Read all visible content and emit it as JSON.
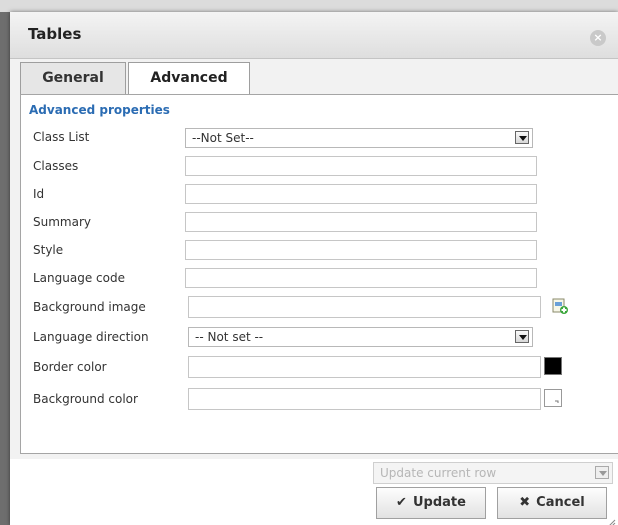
{
  "dialog": {
    "title": "Tables",
    "tabs": [
      {
        "label": "General",
        "active": false
      },
      {
        "label": "Advanced",
        "active": true
      }
    ],
    "section_legend": "Advanced properties",
    "fields": {
      "class_list": {
        "label": "Class List",
        "value": "--Not Set--"
      },
      "classes": {
        "label": "Classes",
        "value": ""
      },
      "id": {
        "label": "Id",
        "value": ""
      },
      "summary": {
        "label": "Summary",
        "value": ""
      },
      "style": {
        "label": "Style",
        "value": ""
      },
      "language_code": {
        "label": "Language code",
        "value": ""
      },
      "background_image": {
        "label": "Background image",
        "value": ""
      },
      "language_direction": {
        "label": "Language direction",
        "value": "-- Not set --"
      },
      "border_color": {
        "label": "Border color",
        "value": "",
        "swatch": "#000000"
      },
      "background_color": {
        "label": "Background color",
        "value": "",
        "swatch": "#ffffff"
      }
    },
    "footer": {
      "apply_scope": "Update current row",
      "update_label": "Update",
      "cancel_label": "Cancel"
    }
  },
  "colors": {
    "accent": "#2b6cb3",
    "panel_bg": "#f2f2f2"
  },
  "icons": [
    "close-icon",
    "browse-image-icon",
    "color-picker-icon",
    "check-icon",
    "cancel-x-icon",
    "resize-grip-icon"
  ]
}
